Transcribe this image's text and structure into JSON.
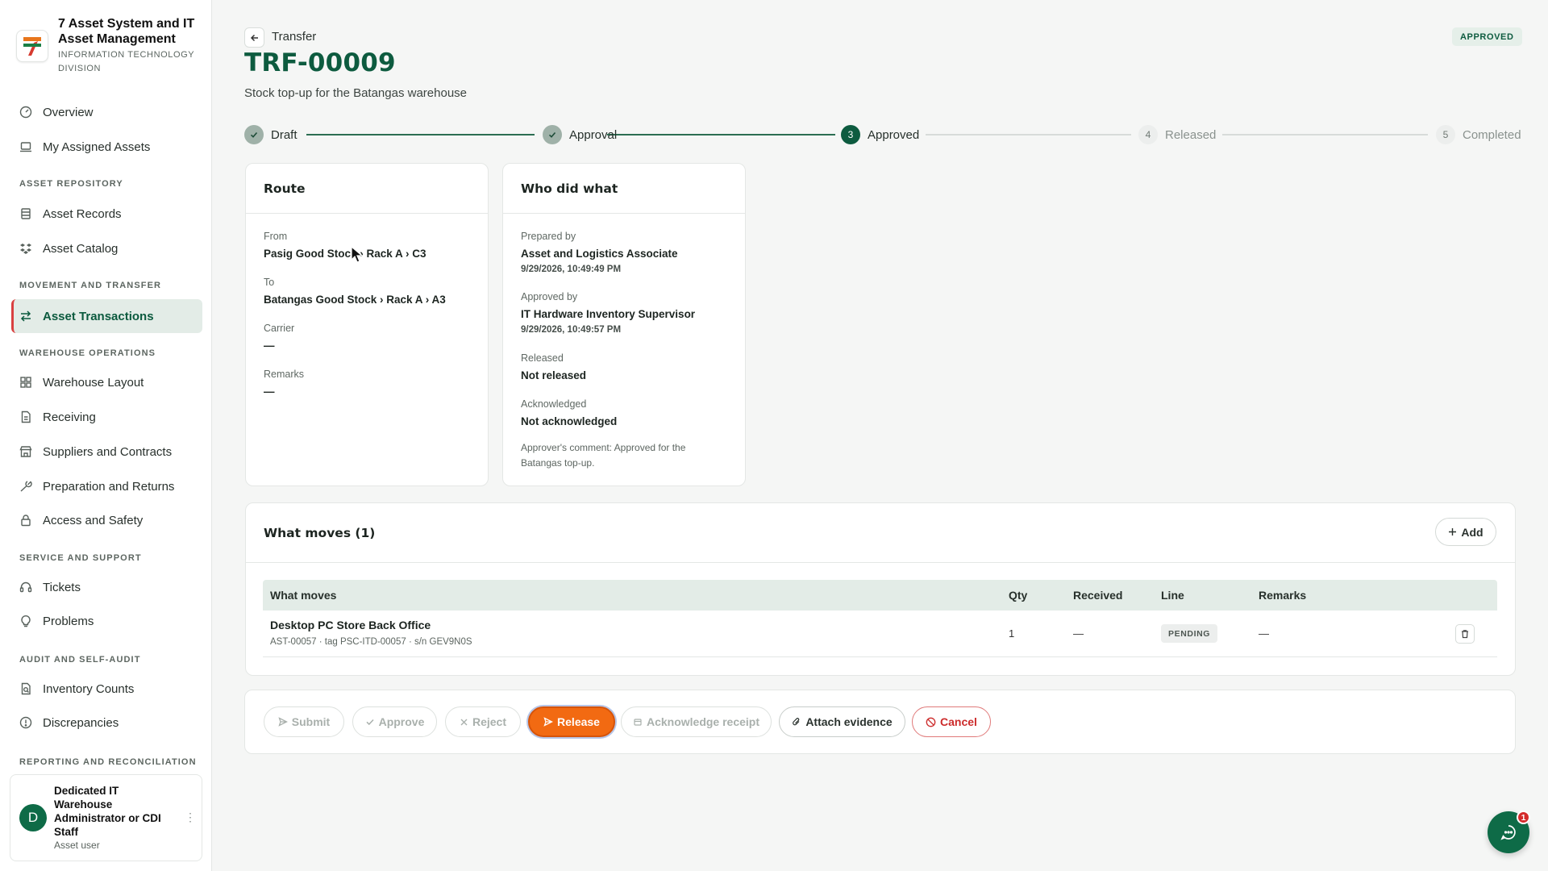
{
  "app": {
    "title": "7 Asset System and IT Asset Management",
    "subtitle": "INFORMATION TECHNOLOGY DIVISION"
  },
  "sidebar": {
    "items": [
      {
        "label": "Overview",
        "icon": "gauge-icon"
      },
      {
        "label": "My Assigned Assets",
        "icon": "laptop-icon"
      }
    ],
    "sections": [
      {
        "title": "ASSET REPOSITORY",
        "items": [
          {
            "label": "Asset Records",
            "icon": "records-icon"
          },
          {
            "label": "Asset Catalog",
            "icon": "catalog-icon"
          }
        ]
      },
      {
        "title": "MOVEMENT AND TRANSFER",
        "items": [
          {
            "label": "Asset Transactions",
            "icon": "transfer-arrows-icon",
            "active": true
          }
        ]
      },
      {
        "title": "WAREHOUSE OPERATIONS",
        "items": [
          {
            "label": "Warehouse Layout",
            "icon": "grid-icon"
          },
          {
            "label": "Receiving",
            "icon": "document-icon"
          },
          {
            "label": "Suppliers and Contracts",
            "icon": "store-icon"
          },
          {
            "label": "Preparation and Returns",
            "icon": "wrench-icon"
          },
          {
            "label": "Access and Safety",
            "icon": "lock-icon"
          }
        ]
      },
      {
        "title": "SERVICE AND SUPPORT",
        "items": [
          {
            "label": "Tickets",
            "icon": "headset-icon"
          },
          {
            "label": "Problems",
            "icon": "lightbulb-icon"
          }
        ]
      },
      {
        "title": "AUDIT AND SELF-AUDIT",
        "items": [
          {
            "label": "Inventory Counts",
            "icon": "count-icon"
          },
          {
            "label": "Discrepancies",
            "icon": "alert-circle-icon"
          }
        ]
      },
      {
        "title": "REPORTING AND RECONCILIATION",
        "items": []
      }
    ],
    "user": {
      "initial": "D",
      "name": "Dedicated IT Warehouse Administrator or CDI Staff",
      "role": "Asset user"
    }
  },
  "header": {
    "breadcrumb": "Transfer",
    "title": "TRF-00009",
    "subtitle": "Stock top-up for the Batangas warehouse",
    "status": "APPROVED"
  },
  "stepper": [
    {
      "label": "Draft",
      "state": "done"
    },
    {
      "label": "Approval",
      "state": "done"
    },
    {
      "num": "3",
      "label": "Approved",
      "state": "current"
    },
    {
      "num": "4",
      "label": "Released",
      "state": "future"
    },
    {
      "num": "5",
      "label": "Completed",
      "state": "future"
    }
  ],
  "route": {
    "title": "Route",
    "from_label": "From",
    "from_value": "Pasig Good Stock › Rack A › C3",
    "to_label": "To",
    "to_value": "Batangas Good Stock › Rack A › A3",
    "carrier_label": "Carrier",
    "carrier_value": "—",
    "remarks_label": "Remarks",
    "remarks_value": "—"
  },
  "who": {
    "title": "Who did what",
    "prepared_label": "Prepared by",
    "prepared_value": "Asset and Logistics Associate",
    "prepared_date": "9/29/2026, 10:49:49 PM",
    "approved_label": "Approved by",
    "approved_value": "IT Hardware Inventory Supervisor",
    "approved_date": "9/29/2026, 10:49:57 PM",
    "released_label": "Released",
    "released_value": "Not released",
    "ack_label": "Acknowledged",
    "ack_value": "Not acknowledged",
    "comment": "Approver's comment: Approved for the Batangas top-up."
  },
  "moves": {
    "title": "What moves (1)",
    "add_label": "Add",
    "columns": [
      "What moves",
      "Qty",
      "Received",
      "Line",
      "Remarks"
    ],
    "rows": [
      {
        "name": "Desktop PC Store Back Office",
        "meta": "AST-00057 · tag PSC-ITD-00057 · s/n GEV9N0S",
        "qty": "1",
        "received": "—",
        "line": "PENDING",
        "remarks": "—"
      }
    ]
  },
  "actions": {
    "submit": "Submit",
    "approve": "Approve",
    "reject": "Reject",
    "release": "Release",
    "acknowledge": "Acknowledge receipt",
    "attach": "Attach evidence",
    "cancel": "Cancel"
  },
  "chat": {
    "badge": "1"
  },
  "colors": {
    "brand_green": "#0d5b3f",
    "release_orange": "#f26a12",
    "cancel_red": "#cc2b2b",
    "active_marker": "#d94040"
  }
}
